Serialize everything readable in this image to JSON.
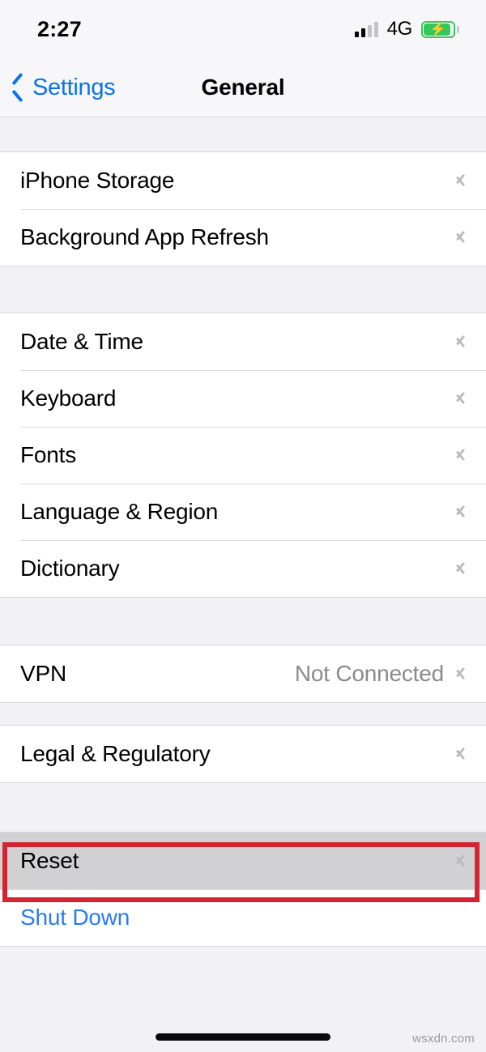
{
  "status_bar": {
    "time": "2:27",
    "network_label": "4G",
    "signal_icon": "cellular-signal-icon",
    "signal_bars_total": 4,
    "signal_bars_filled": 2,
    "battery_icon": "battery-charging-icon",
    "battery_color": "#35c759",
    "battery_charging": true
  },
  "nav_bar": {
    "back_label": "Settings",
    "back_icon": "chevron-left-icon",
    "title": "General",
    "accent_color": "#0b72ef"
  },
  "groups": [
    {
      "id": "storage-group",
      "rows": [
        {
          "label": "iPhone Storage",
          "value": "",
          "accessory": "chevron-right-icon",
          "style": "default"
        },
        {
          "label": "Background App Refresh",
          "value": "",
          "accessory": "chevron-right-icon",
          "style": "default"
        }
      ]
    },
    {
      "id": "localization-group",
      "rows": [
        {
          "label": "Date & Time",
          "value": "",
          "accessory": "chevron-right-icon",
          "style": "default"
        },
        {
          "label": "Keyboard",
          "value": "",
          "accessory": "chevron-right-icon",
          "style": "default"
        },
        {
          "label": "Fonts",
          "value": "",
          "accessory": "chevron-right-icon",
          "style": "default"
        },
        {
          "label": "Language & Region",
          "value": "",
          "accessory": "chevron-right-icon",
          "style": "default"
        },
        {
          "label": "Dictionary",
          "value": "",
          "accessory": "chevron-right-icon",
          "style": "default"
        }
      ]
    },
    {
      "id": "vpn-group",
      "rows": [
        {
          "label": "VPN",
          "value": "Not Connected",
          "accessory": "chevron-right-icon",
          "style": "default"
        }
      ]
    },
    {
      "id": "legal-group",
      "rows": [
        {
          "label": "Legal & Regulatory",
          "value": "",
          "accessory": "chevron-right-icon",
          "style": "default"
        }
      ]
    },
    {
      "id": "reset-group",
      "rows": [
        {
          "label": "Reset",
          "value": "",
          "accessory": "chevron-right-icon",
          "style": "pressed"
        },
        {
          "label": "Shut Down",
          "value": "",
          "accessory": "none",
          "style": "blue"
        }
      ]
    }
  ],
  "annotation": {
    "target": "Reset",
    "shape": "rectangle",
    "color": "#d42432"
  },
  "footer": {
    "watermark": "wsxdn.com",
    "home_indicator": "home-indicator"
  }
}
